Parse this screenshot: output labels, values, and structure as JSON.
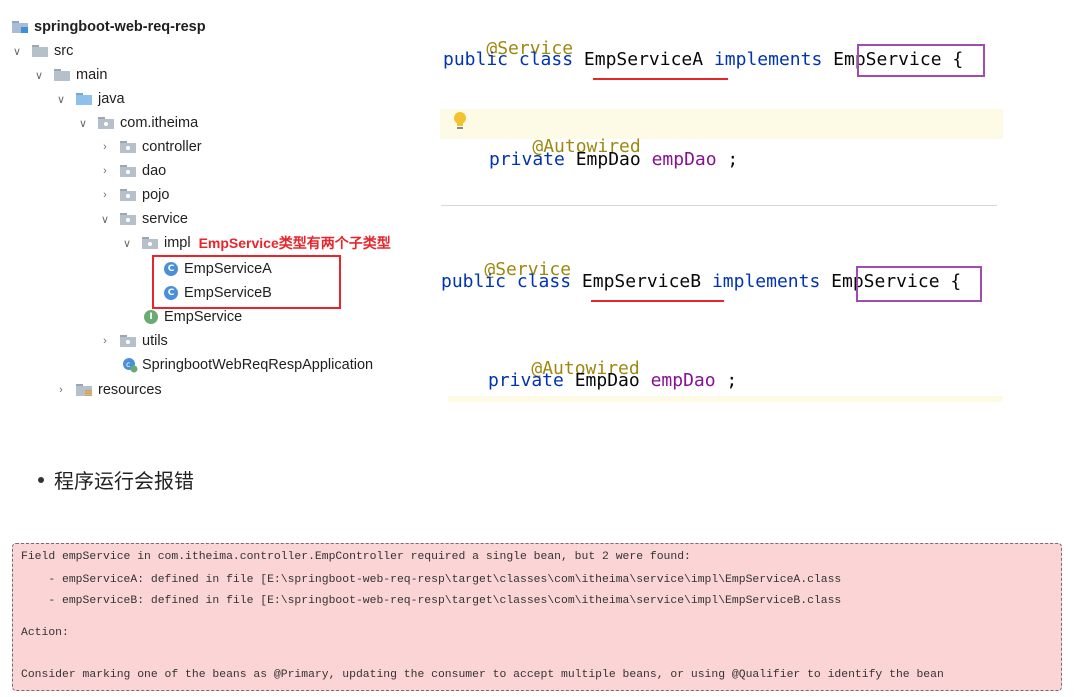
{
  "tree": {
    "project": "springboot-web-req-resp",
    "src": "src",
    "main": "main",
    "java": "java",
    "pkg": "com.itheima",
    "controller": "controller",
    "dao": "dao",
    "pojo": "pojo",
    "service": "service",
    "impl": "impl",
    "class_a": "EmpServiceA",
    "class_b": "EmpServiceB",
    "interface": "EmpService",
    "utils": "utils",
    "app": "SpringbootWebReqRespApplication",
    "resources": "resources",
    "class_badge": "C",
    "interface_badge": "I"
  },
  "annotation": "EmpService类型有两个子类型",
  "code_a": {
    "annotation": "@Service",
    "kw1": "public class ",
    "classname": "EmpServiceA",
    "kw2": " implements ",
    "iface": "EmpService",
    "brace": " {",
    "autowired": "@Autowired",
    "field_kw": "private ",
    "field_type": "EmpDao ",
    "field_name": "empDao",
    "field_end": " ;"
  },
  "code_b": {
    "annotation": "@Service",
    "kw1": "public class ",
    "classname": "EmpServiceB",
    "kw2": " implements ",
    "iface": "EmpService",
    "brace": " {",
    "autowired": "@Autowired",
    "field_kw": "private ",
    "field_type": "EmpDao ",
    "field_name": "empDao",
    "field_end": " ;"
  },
  "bullet": "程序运行会报错",
  "error": {
    "line1": "Field empService in com.itheima.controller.EmpController required a single bean, but 2 were found:",
    "line2": "    - empServiceA: defined in file [E:\\springboot-web-req-resp\\target\\classes\\com\\itheima\\service\\impl\\EmpServiceA.class",
    "line3": "    - empServiceB: defined in file [E:\\springboot-web-req-resp\\target\\classes\\com\\itheima\\service\\impl\\EmpServiceB.class",
    "line4": "Action:",
    "line5": "Consider marking one of the beans as @Primary, updating the consumer to accept multiple beans, or using @Qualifier to identify the bean"
  },
  "colors": {
    "keyword": "#0033b3",
    "annotation": "#9e880d",
    "field": "#871094",
    "red": "#e8252b",
    "purple": "#a24bb3",
    "error_bg": "#fbd5d5"
  }
}
